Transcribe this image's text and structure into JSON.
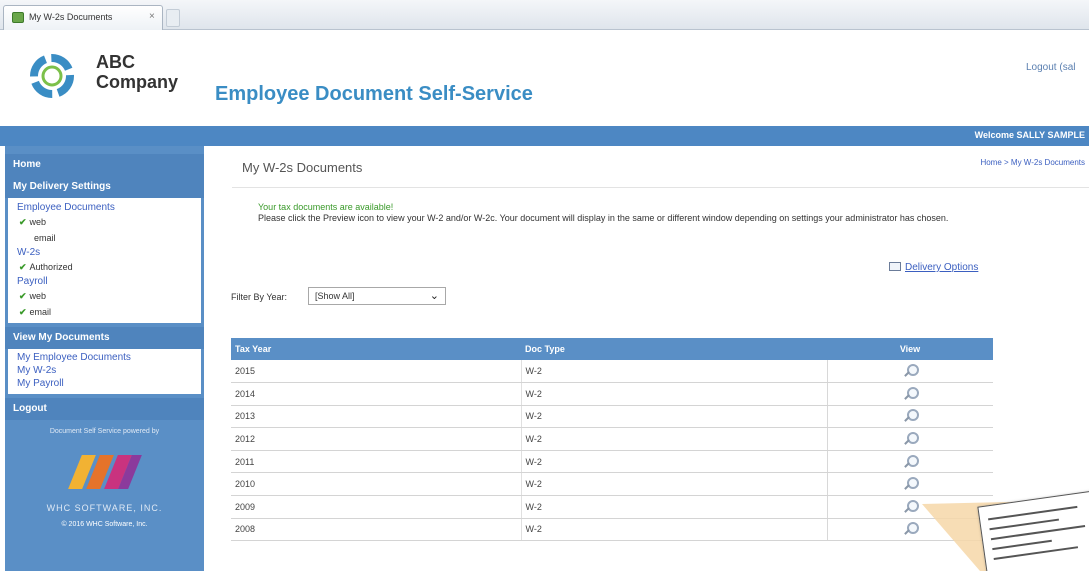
{
  "browser": {
    "tab_title": "My W-2s Documents",
    "tab_close": "×"
  },
  "header": {
    "logo_line1": "ABC",
    "logo_line2": "Company",
    "site_title": "Employee Document Self-Service",
    "logout_link": "Logout (sal"
  },
  "topbar": {
    "welcome": "Welcome SALLY SAMPLE"
  },
  "sidebar": {
    "home": "Home",
    "delivery_settings_heading": "My Delivery Settings",
    "delivery_groups": [
      {
        "label": "Employee Documents",
        "items": [
          {
            "label": "web",
            "checked": true
          },
          {
            "label": "email",
            "checked": false
          }
        ]
      },
      {
        "label": "W-2s",
        "items": [
          {
            "label": "Authorized",
            "checked": true
          }
        ]
      },
      {
        "label": "Payroll",
        "items": [
          {
            "label": "web",
            "checked": true
          },
          {
            "label": "email",
            "checked": true
          }
        ]
      }
    ],
    "view_heading": "View My Documents",
    "view_links": [
      "My Employee Documents",
      "My W-2s",
      "My Payroll"
    ],
    "logout": "Logout",
    "powered_by": "Document Self Service powered by",
    "brand": "WHC SOFTWARE, INC.",
    "copyright": "© 2016 WHC Software, Inc."
  },
  "main": {
    "page_title": "My W-2s Documents",
    "breadcrumb": "Home > My W-2s Documents",
    "notice_title": "Your tax documents are available!",
    "notice_body": "Please click the Preview icon to view your W-2 and/or W-2c.  Your document will display in the same or different window depending on settings your administrator has chosen.",
    "delivery_options": "Delivery Options",
    "filter_label": "Filter By Year:",
    "filter_value": "[Show All]"
  },
  "table": {
    "columns": [
      "Tax Year",
      "Doc Type",
      "View"
    ],
    "rows": [
      {
        "year": "2015",
        "type": "W-2"
      },
      {
        "year": "2014",
        "type": "W-2"
      },
      {
        "year": "2013",
        "type": "W-2"
      },
      {
        "year": "2012",
        "type": "W-2"
      },
      {
        "year": "2011",
        "type": "W-2"
      },
      {
        "year": "2010",
        "type": "W-2"
      },
      {
        "year": "2009",
        "type": "W-2"
      },
      {
        "year": "2008",
        "type": "W-2"
      }
    ]
  },
  "colors": {
    "brand_blue": "#4d87c3",
    "title_blue": "#3a8dc4",
    "check_green": "#3a9a2a",
    "link_blue": "#3b5fc0"
  },
  "icons": [
    "favicon-icon",
    "close-icon",
    "logo-icon",
    "check-icon",
    "delivery-options-icon",
    "chevron-down-icon",
    "magnifier-icon"
  ]
}
